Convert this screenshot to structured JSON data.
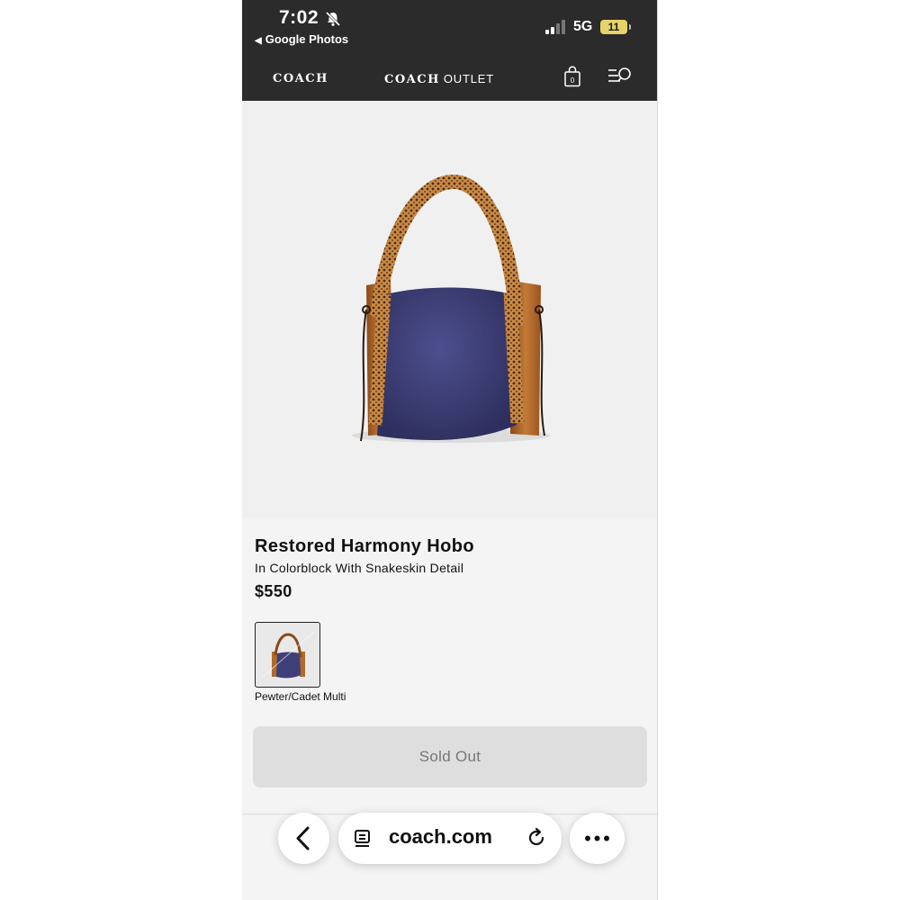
{
  "status_bar": {
    "time": "7:02",
    "back_app": "Google Photos",
    "network": "5G",
    "battery": "11"
  },
  "header": {
    "brand_main": "COACH",
    "brand_outlet_main": "COACH",
    "brand_outlet_suffix": "OUTLET",
    "cart_count": "0",
    "icons": [
      "bag-icon",
      "menu-search-icon"
    ]
  },
  "product": {
    "title": "Restored Harmony Hobo",
    "subtitle": "In Colorblock With Snakeskin Detail",
    "price": "$550",
    "color_name": "Pewter/Cadet Multi",
    "button_label": "Sold Out"
  },
  "browser": {
    "url": "coach.com",
    "icons": [
      "back-icon",
      "tabs-icon",
      "reload-icon",
      "more-icon"
    ]
  },
  "colors": {
    "header_bg": "#2b2b2b",
    "page_bg": "#f4f4f5",
    "bag_body": "#3e3f78",
    "bag_leather": "#b06a2a",
    "button_bg": "#dedede"
  }
}
